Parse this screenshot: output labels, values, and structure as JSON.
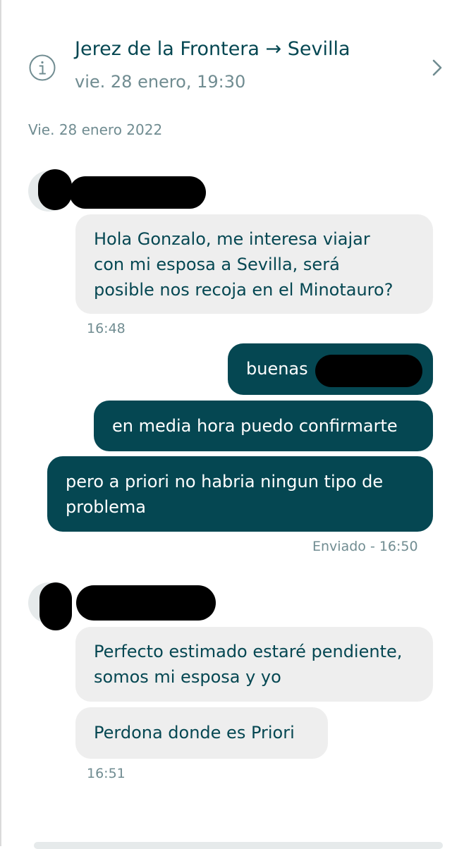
{
  "header": {
    "route": "Jerez de la Frontera → Sevilla",
    "datetime": "vie. 28 enero, 19:30"
  },
  "conversation": {
    "day_label": "Vie. 28 enero 2022",
    "groups": [
      {
        "sender": "other",
        "messages": [
          "Hola Gonzalo, me interesa viajar\ncon mi esposa a Sevilla, será\nposible nos recoja en el Minotauro?"
        ],
        "meta": "16:48"
      },
      {
        "sender": "me",
        "messages": [
          "buenas",
          "en media hora puedo confirmarte",
          "pero a priori no habria ningun tipo de\nproblema"
        ],
        "meta": "Enviado - 16:50"
      },
      {
        "sender": "other",
        "messages": [
          "Perfecto estimado estaré pendiente,\nsomos mi esposa y yo",
          "Perdona donde es Priori"
        ],
        "meta": "16:51"
      }
    ]
  },
  "colors": {
    "primary": "#054752",
    "secondary_text": "#708c91",
    "incoming_bubble": "#eeeeee",
    "outgoing_bubble": "#054752"
  },
  "icons": {
    "info": "info-icon",
    "chevron": "chevron-right-icon"
  }
}
